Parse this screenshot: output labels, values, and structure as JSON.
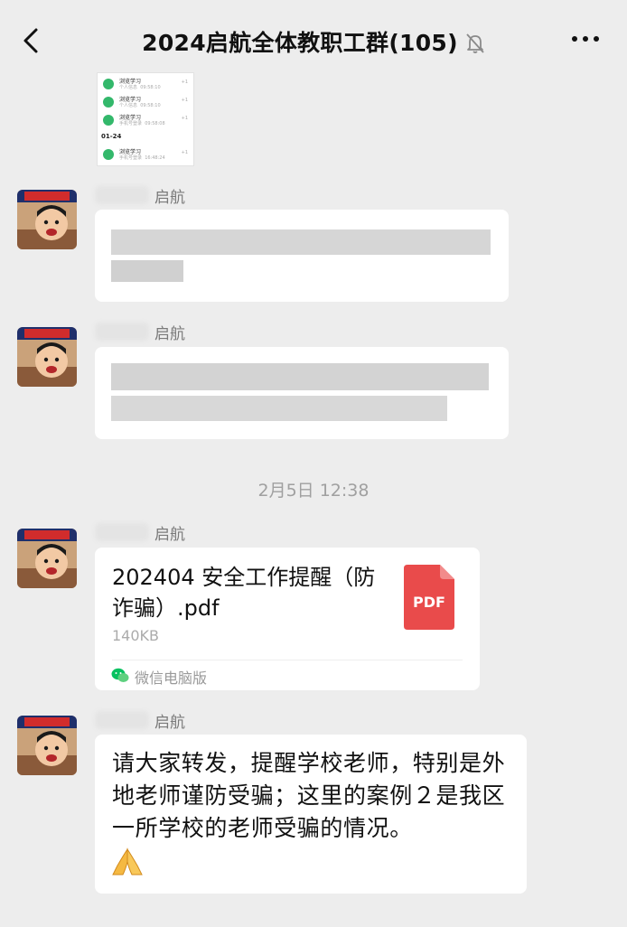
{
  "header": {
    "title": "2024启航全体教职工群(105)",
    "back_icon": "chevron-left-icon",
    "mute_icon": "bell-off-icon",
    "more_icon": "more-dots-icon"
  },
  "thumbnail": {
    "rows": [
      {
        "name": "浏览学习",
        "sub": "个人信息",
        "time": "09:58:10",
        "count": "+1"
      },
      {
        "name": "浏览学习",
        "sub": "个人信息",
        "time": "09:58:10",
        "count": "+1"
      },
      {
        "name": "浏览学习",
        "sub": "手机号登录",
        "time": "09:58:08",
        "count": "+1"
      }
    ],
    "date": "01-24",
    "last_row": {
      "name": "浏览学习",
      "sub": "手机号登录",
      "time": "16:48:24",
      "count": "+1"
    }
  },
  "messages": [
    {
      "sender": "启航",
      "type": "text-blurred"
    },
    {
      "sender": "启航",
      "type": "text-blurred"
    },
    {
      "sender": "启航",
      "type": "file"
    },
    {
      "sender": "启航",
      "type": "text"
    }
  ],
  "timestamp": "2月5日 12:38",
  "file_message": {
    "file_name": "202404 安全工作提醒（防诈骗）.pdf",
    "file_size": "140KB",
    "file_icon_label": "PDF",
    "source": "微信电脑版",
    "source_icon": "wechat-icon"
  },
  "text_message": {
    "text": "请大家转发，提醒学校老师，特别是外地老师谨防受骗；这里的案例２是我区一所学校的老师受骗的情况。",
    "emoji": "praying-hands-icon"
  },
  "colors": {
    "background": "#ededed",
    "bubble": "#ffffff",
    "pdf_red": "#e94b4b",
    "wechat_green": "#07c160"
  }
}
